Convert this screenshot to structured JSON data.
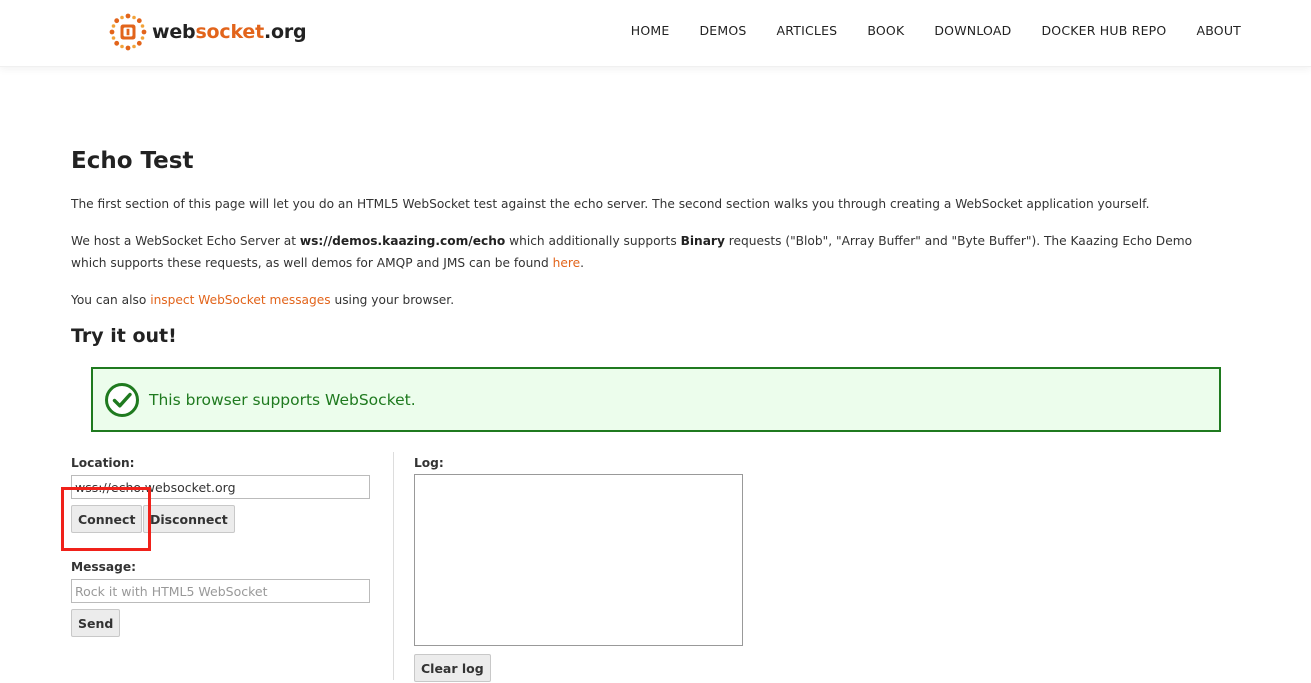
{
  "header": {
    "logo": {
      "part1": "web",
      "part2": "socket",
      "part3": ".org"
    },
    "nav": [
      "HOME",
      "DEMOS",
      "ARTICLES",
      "BOOK",
      "DOWNLOAD",
      "DOCKER HUB REPO",
      "ABOUT"
    ]
  },
  "main": {
    "title": "Echo Test",
    "intro": "The first section of this page will let you do an HTML5 WebSocket test against the echo server. The second section walks you through creating a WebSocket application yourself.",
    "host": {
      "t1": "We host a WebSocket Echo Server at ",
      "server": "ws://demos.kaazing.com/echo",
      "t2": " which additionally supports ",
      "binary": "Binary",
      "t3": " requests (\"Blob\", \"Array Buffer\" and \"Byte Buffer\"). The Kaazing Echo Demo which supports these requests, as well demos for AMQP and JMS can be found ",
      "link": "here",
      "t4": "."
    },
    "inspect": {
      "t1": "You can also ",
      "link": "inspect WebSocket messages",
      "t2": " using your browser."
    },
    "try_title": "Try it out!",
    "support_msg": "This browser supports WebSocket."
  },
  "form": {
    "location_label": "Location:",
    "location_value": "wss://echo.websocket.org",
    "connect": "Connect",
    "disconnect": "Disconnect",
    "message_label": "Message:",
    "message_placeholder": "Rock it with HTML5 WebSocket",
    "send": "Send",
    "log_label": "Log:",
    "clear_log": "Clear log"
  },
  "colors": {
    "accent": "#e2641b",
    "success": "#1f7a1f",
    "highlight": "#f0211a"
  }
}
